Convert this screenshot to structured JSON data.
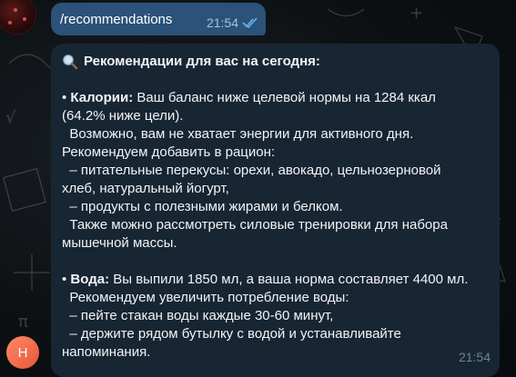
{
  "chat": {
    "outgoing": {
      "text": "/recommendations",
      "time": "21:54",
      "status_icon": "double-check-icon"
    },
    "incoming": {
      "header_icon": "magnifier-icon",
      "header": "Рекомендации для вас на сегодня:",
      "calories": {
        "bullet": "• ",
        "label": "Калории:",
        "line1_rest": " Ваш баланс ниже целевой нормы на 1284 ккал",
        "lines": [
          "(64.2% ниже цели).",
          "  Возможно, вам не хватает энергии для активного дня.",
          "Рекомендуем добавить в рацион:",
          "  – питательные перекусы: орехи, авокадо, цельнозерновой",
          "хлеб, натуральный йогурт,",
          "  – продукты с полезными жирами и белком.",
          "  Также можно рассмотреть силовые тренировки для набора",
          "мышечной массы."
        ]
      },
      "water": {
        "bullet": "• ",
        "label": "Вода:",
        "line1_rest": " Вы выпили 1850 мл, а ваша норма составляет 4400 мл.",
        "lines": [
          "  Рекомендуем увеличить потребление воды:",
          "  – пейте стакан воды каждые 30-60 минут,",
          "  – держите рядом бутылку с водой и устанавливайте",
          "напоминания."
        ]
      },
      "time": "21:54"
    },
    "sender_avatar_letter": "Н",
    "colors": {
      "outgoing_bubble": "#2b5278",
      "incoming_bubble": "#182533",
      "avatar": "#e8553a"
    }
  }
}
